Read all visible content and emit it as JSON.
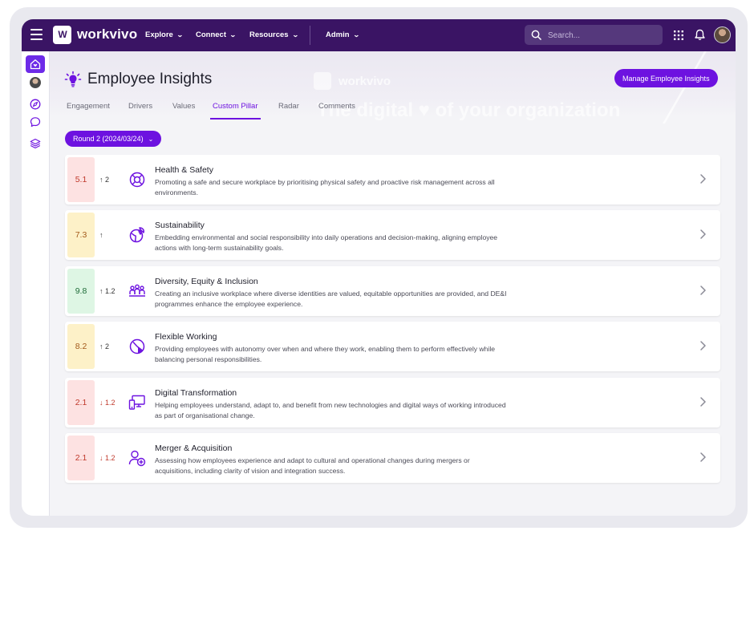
{
  "topbar": {
    "logo_glyph": "W",
    "brand": "workvivo",
    "nav": [
      {
        "label": "Explore"
      },
      {
        "label": "Connect"
      },
      {
        "label": "Resources"
      },
      {
        "label": "Admin"
      }
    ],
    "search_placeholder": "Search..."
  },
  "watermark": {
    "brand": "workvivo",
    "tagline": "The digital ♥ of your organization"
  },
  "page": {
    "title": "Employee Insights",
    "manage_button": "Manage Employee Insights",
    "tabs": [
      {
        "label": "Engagement",
        "active": false
      },
      {
        "label": "Drivers",
        "active": false
      },
      {
        "label": "Values",
        "active": false
      },
      {
        "label": "Custom Pillar",
        "active": true
      },
      {
        "label": "Radar",
        "active": false
      },
      {
        "label": "Comments",
        "active": false
      }
    ],
    "round_selector": "Round 2 (2024/03/24)"
  },
  "colors": {
    "accent": "#6d12e0",
    "topbar": "#3a1464",
    "score_red_bg": "#fde2e2",
    "score_yellow_bg": "#fdf1c8",
    "score_green_bg": "#def6e4"
  },
  "pillars": [
    {
      "score": "5.1",
      "score_tone": "red",
      "arrow": "↑",
      "delta": "2",
      "trend": "up",
      "icon": "lifebuoy-icon",
      "title": "Health & Safety",
      "description": "Promoting a safe and secure workplace by prioritising physical safety and proactive risk management across all environments."
    },
    {
      "score": "7.3",
      "score_tone": "yellow",
      "arrow": "↑",
      "delta": "",
      "trend": "up",
      "icon": "globe-leaf-icon",
      "title": "Sustainability",
      "description": "Embedding environmental and social responsibility into daily operations and decision-making, aligning employee actions with long-term sustainability goals."
    },
    {
      "score": "9.8",
      "score_tone": "green",
      "arrow": "↑",
      "delta": "1.2",
      "trend": "up",
      "icon": "people-group-icon",
      "title": "Diversity, Equity & Inclusion",
      "description": "Creating an inclusive workplace where diverse identities are valued, equitable opportunities are provided, and DE&I programmes enhance the employee experience."
    },
    {
      "score": "8.2",
      "score_tone": "yellow",
      "arrow": "↑",
      "delta": "2",
      "trend": "up",
      "icon": "clock-pie-icon",
      "title": "Flexible Working",
      "description": "Providing employees with autonomy over when and where they work, enabling them to perform effectively while balancing personal responsibilities."
    },
    {
      "score": "2.1",
      "score_tone": "red",
      "arrow": "↓",
      "delta": "1.2",
      "trend": "down",
      "icon": "devices-icon",
      "title": "Digital Transformation",
      "description": "Helping employees understand, adapt to, and benefit from new technologies and digital ways of working introduced as part of organisational change."
    },
    {
      "score": "2.1",
      "score_tone": "red",
      "arrow": "↓",
      "delta": "1.2",
      "trend": "down",
      "icon": "user-add-icon",
      "title": "Merger & Acquisition",
      "description": "Assessing how employees experience and adapt to cultural and operational changes during mergers or acquisitions, including clarity of vision and integration success."
    }
  ]
}
